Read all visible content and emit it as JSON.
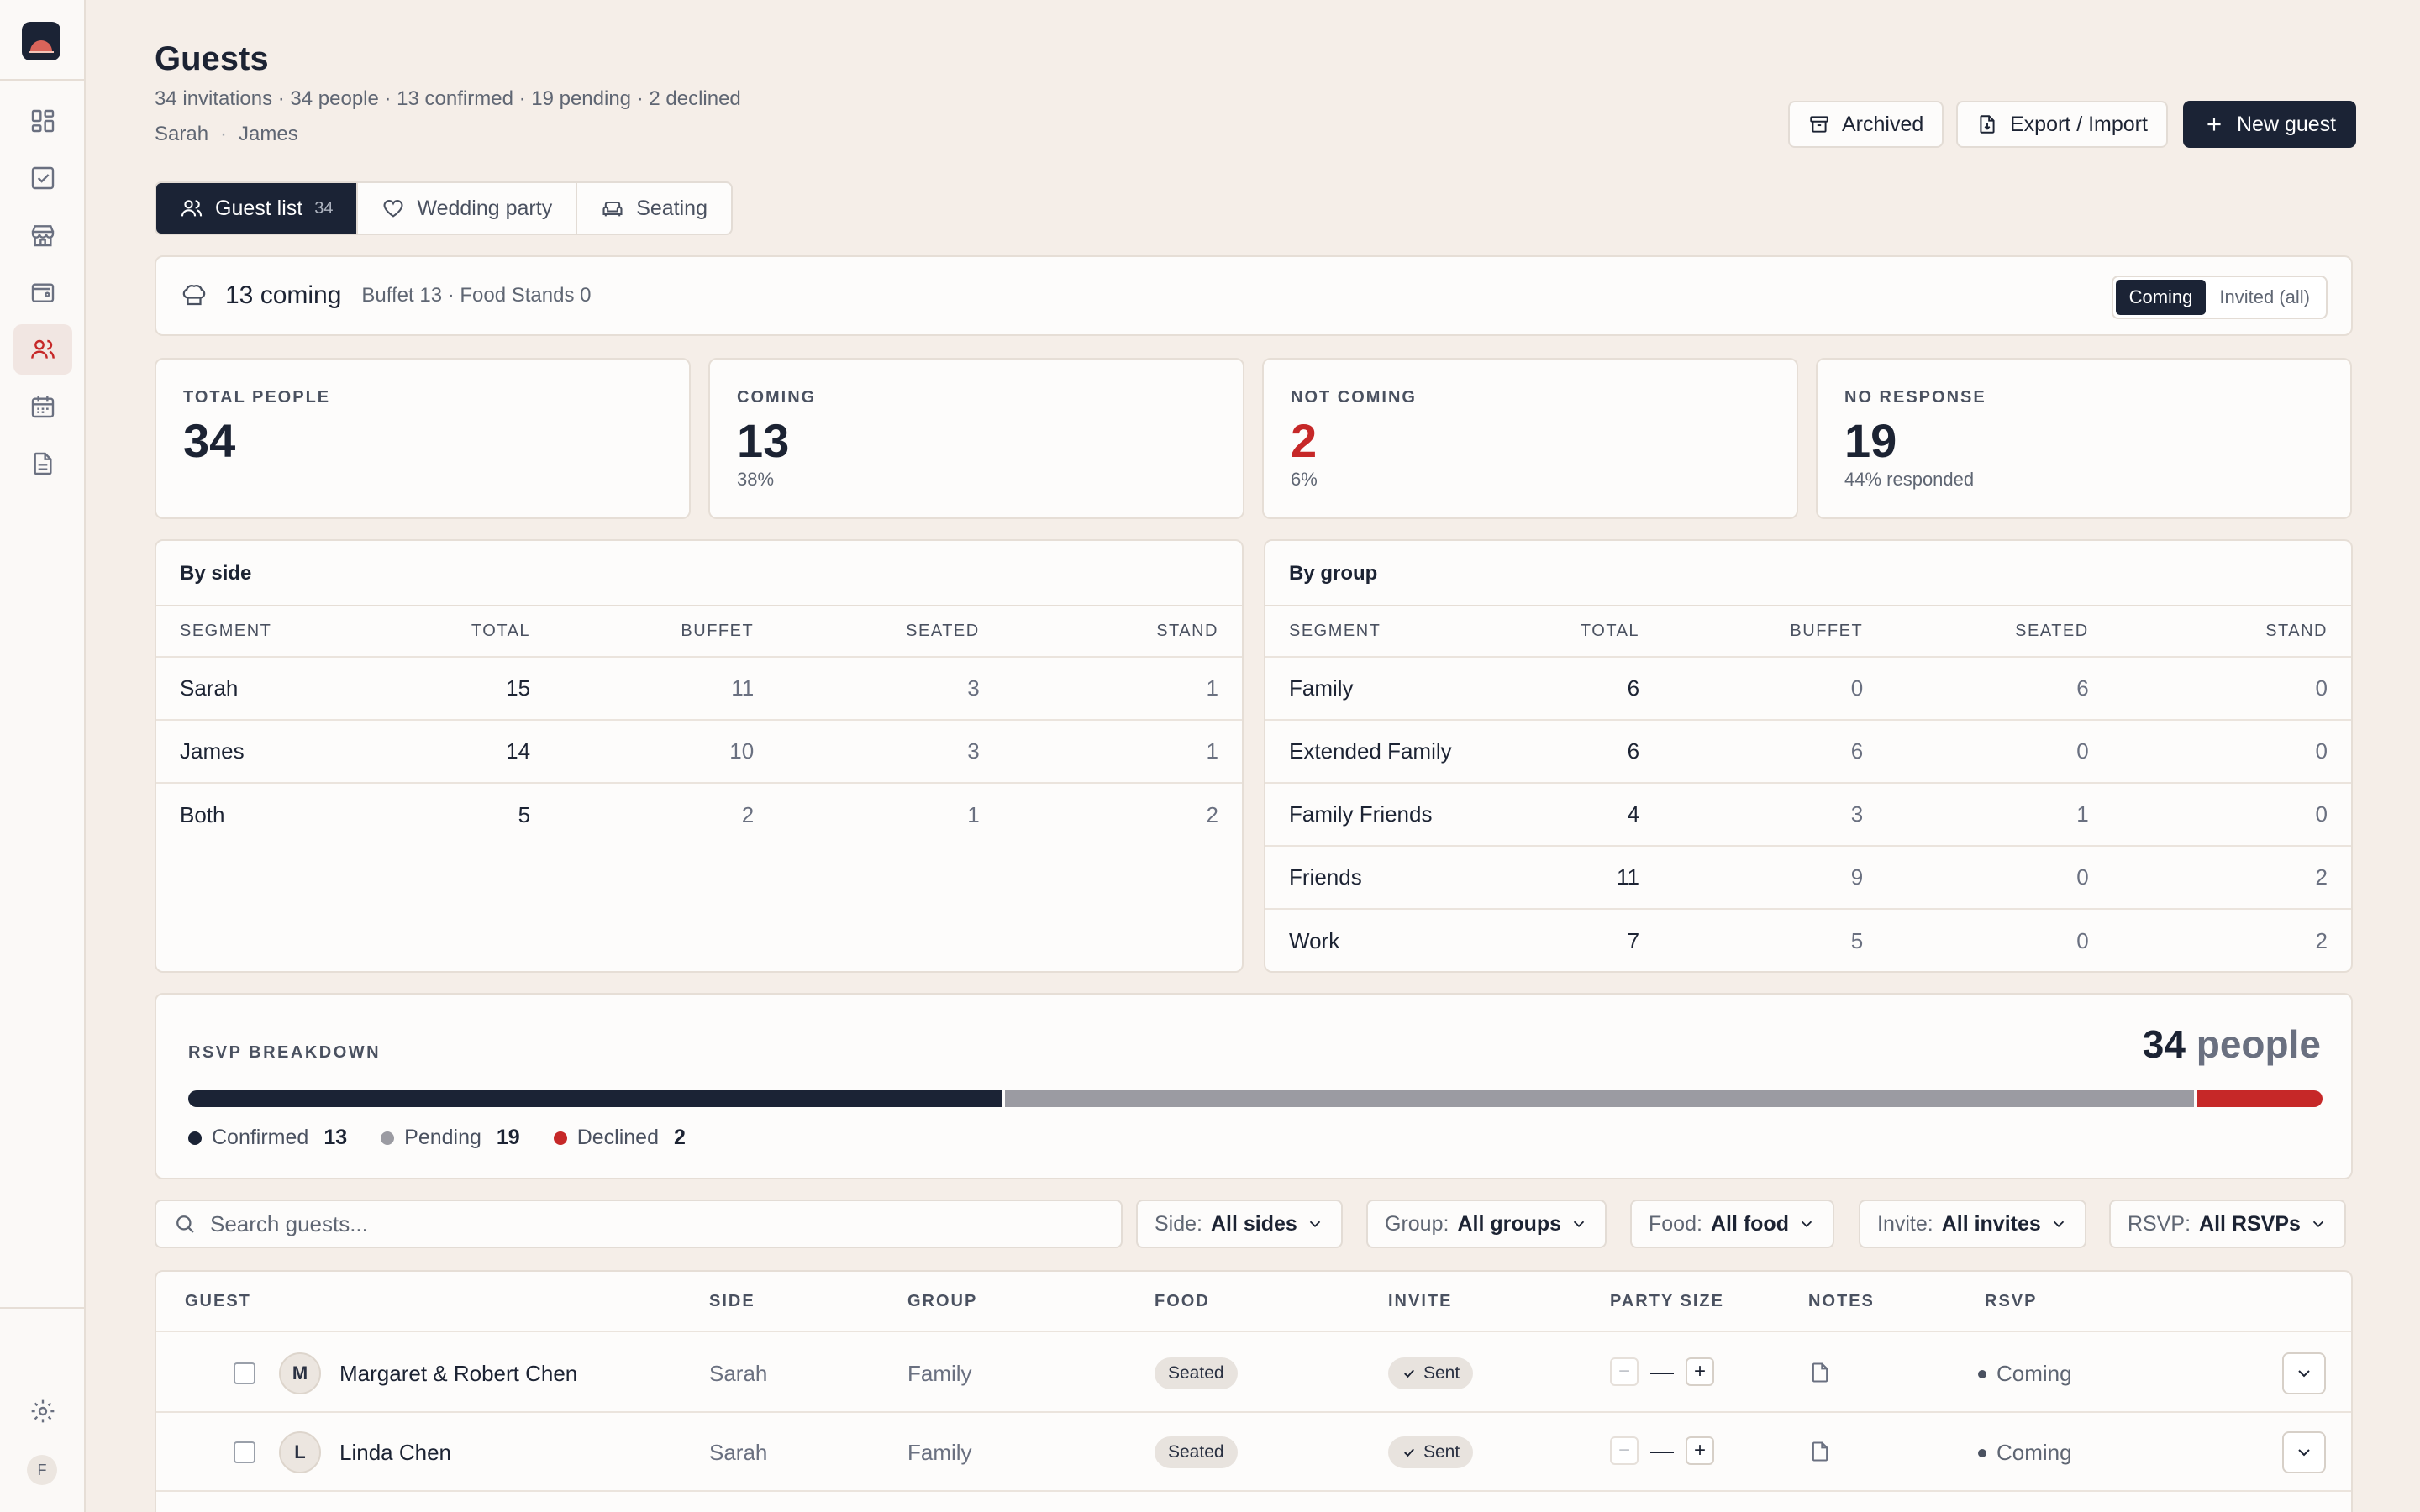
{
  "page": {
    "title": "Guests",
    "subtitle": "34 invitations · 34 people · 13 confirmed · 19 pending · 2 declined",
    "partner_a": "Sarah",
    "partner_sep": "·",
    "partner_b": "James"
  },
  "sidebar": {
    "items": [
      {
        "icon": "dashboard-icon"
      },
      {
        "icon": "checklist-icon"
      },
      {
        "icon": "vendors-icon"
      },
      {
        "icon": "budget-icon"
      },
      {
        "icon": "guests-icon",
        "active": true
      },
      {
        "icon": "calendar-icon"
      },
      {
        "icon": "documents-icon"
      }
    ],
    "settings_icon": "gear-icon",
    "user_initial": "F"
  },
  "header_actions": {
    "archived": "Archived",
    "export_import": "Export / Import",
    "new_guest": "New guest"
  },
  "tabs": [
    {
      "label": "Guest list",
      "count": "34",
      "active": true
    },
    {
      "label": "Wedding party"
    },
    {
      "label": "Seating"
    }
  ],
  "coming_bar": {
    "summary": "13 coming",
    "detail": "Buffet 13 · Food Stands 0",
    "toggle": [
      "Coming",
      "Invited (all)"
    ],
    "toggle_selected": "Coming"
  },
  "stats": [
    {
      "label": "TOTAL PEOPLE",
      "value": "34",
      "sub": ""
    },
    {
      "label": "COMING",
      "value": "13",
      "sub": "38%"
    },
    {
      "label": "NOT COMING",
      "value": "2",
      "sub": "6%"
    },
    {
      "label": "NO RESPONSE",
      "value": "19",
      "sub": "44% responded"
    }
  ],
  "by_side": {
    "title": "By side",
    "columns": [
      "SEGMENT",
      "TOTAL",
      "BUFFET",
      "SEATED",
      "STAND"
    ],
    "rows": [
      [
        "Sarah",
        "15",
        "11",
        "3",
        "1"
      ],
      [
        "James",
        "14",
        "10",
        "3",
        "1"
      ],
      [
        "Both",
        "5",
        "2",
        "1",
        "2"
      ]
    ]
  },
  "by_group": {
    "title": "By group",
    "columns": [
      "SEGMENT",
      "TOTAL",
      "BUFFET",
      "SEATED",
      "STAND"
    ],
    "rows": [
      [
        "Family",
        "6",
        "0",
        "6",
        "0"
      ],
      [
        "Extended Family",
        "6",
        "6",
        "0",
        "0"
      ],
      [
        "Family Friends",
        "4",
        "3",
        "1",
        "0"
      ],
      [
        "Friends",
        "11",
        "9",
        "0",
        "2"
      ],
      [
        "Work",
        "7",
        "5",
        "0",
        "2"
      ]
    ]
  },
  "rsvp_breakdown": {
    "label": "RSVP BREAKDOWN",
    "total_value": "34",
    "total_unit": "people",
    "segments": [
      {
        "name": "Confirmed",
        "count": 13,
        "color": "#1b2335"
      },
      {
        "name": "Pending",
        "count": 19,
        "color": "#9b9ba2"
      },
      {
        "name": "Declined",
        "count": 2,
        "color": "#c62828"
      }
    ]
  },
  "filters": {
    "search_placeholder": "Search guests...",
    "items": [
      {
        "key": "Side:",
        "value": "All sides"
      },
      {
        "key": "Group:",
        "value": "All groups"
      },
      {
        "key": "Food:",
        "value": "All food"
      },
      {
        "key": "Invite:",
        "value": "All invites"
      },
      {
        "key": "RSVP:",
        "value": "All RSVPs"
      }
    ]
  },
  "guest_table": {
    "columns": [
      "GUEST",
      "SIDE",
      "GROUP",
      "FOOD",
      "INVITE",
      "PARTY SIZE",
      "NOTES",
      "RSVP"
    ],
    "rows": [
      {
        "initial": "M",
        "name": "Margaret & Robert Chen",
        "side": "Sarah",
        "group": "Family",
        "food": "Seated",
        "invite": "Sent",
        "party": "—",
        "rsvp": "Coming"
      },
      {
        "initial": "L",
        "name": "Linda Chen",
        "side": "Sarah",
        "group": "Family",
        "food": "Seated",
        "invite": "Sent",
        "party": "—",
        "rsvp": "Coming"
      }
    ]
  }
}
